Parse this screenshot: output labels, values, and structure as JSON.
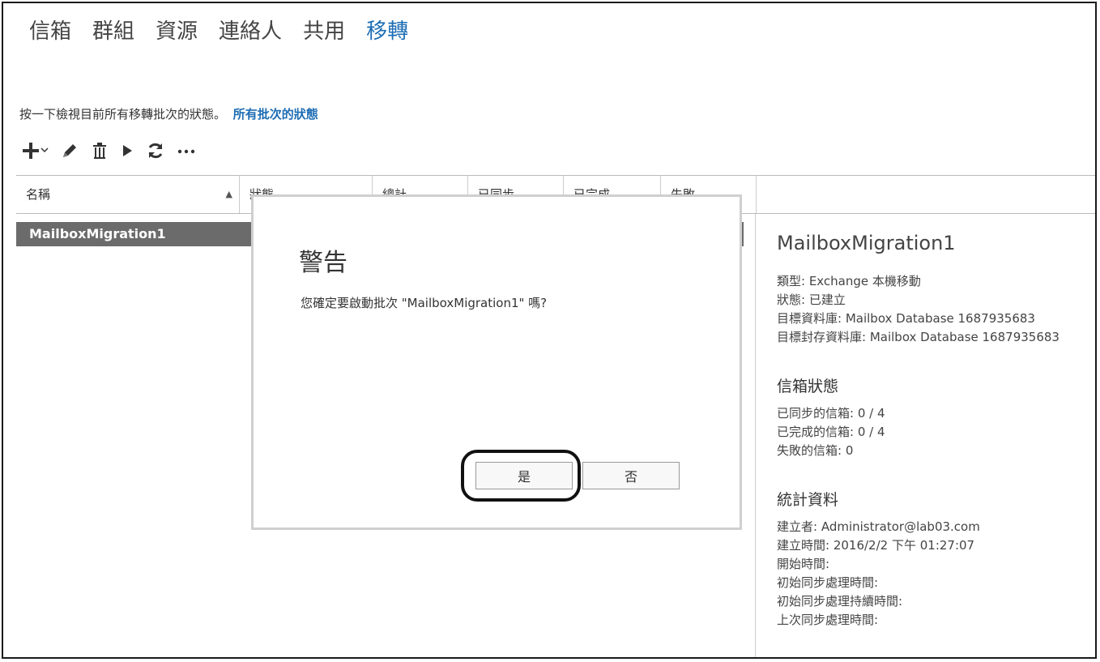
{
  "nav": {
    "tabs": [
      "信箱",
      "群組",
      "資源",
      "連絡人",
      "共用",
      "移轉"
    ],
    "active": "移轉"
  },
  "description": {
    "text": "按一下檢視目前所有移轉批次的狀態。",
    "link": "所有批次的狀態"
  },
  "toolbar": {
    "icons": [
      "add-icon",
      "dropdown-arrow-icon",
      "edit-icon",
      "delete-icon",
      "start-icon",
      "refresh-icon",
      "more-icon"
    ]
  },
  "table": {
    "columns": [
      "名稱",
      "狀態",
      "總計",
      "已同步",
      "已完成",
      "失敗"
    ],
    "sort_indicator": "▲",
    "rows": [
      {
        "name": "MailboxMigration1"
      }
    ]
  },
  "details": {
    "title": "MailboxMigration1",
    "lines": [
      "類型: Exchange 本機移動",
      "狀態: 已建立",
      "目標資料庫: Mailbox Database 1687935683",
      "目標封存資料庫: Mailbox Database 1687935683"
    ],
    "mailbox_status_title": "信箱狀態",
    "mailbox_status": [
      "已同步的信箱: 0 / 4",
      "已完成的信箱: 0 / 4",
      "失敗的信箱: 0"
    ],
    "stats_title": "統計資料",
    "stats": [
      "建立者: Administrator@lab03.com",
      "建立時間: 2016/2/2 下午 01:27:07",
      "開始時間:",
      "初始同步處理時間:",
      "初始同步處理持續時間:",
      "上次同步處理時間:"
    ]
  },
  "dialog": {
    "title": "警告",
    "message": "您確定要啟動批次 \"MailboxMigration1\" 嗎?",
    "yes_label": "是",
    "no_label": "否"
  },
  "colors": {
    "accent": "#1d6db4",
    "selected_row": "#6b6b6b"
  }
}
